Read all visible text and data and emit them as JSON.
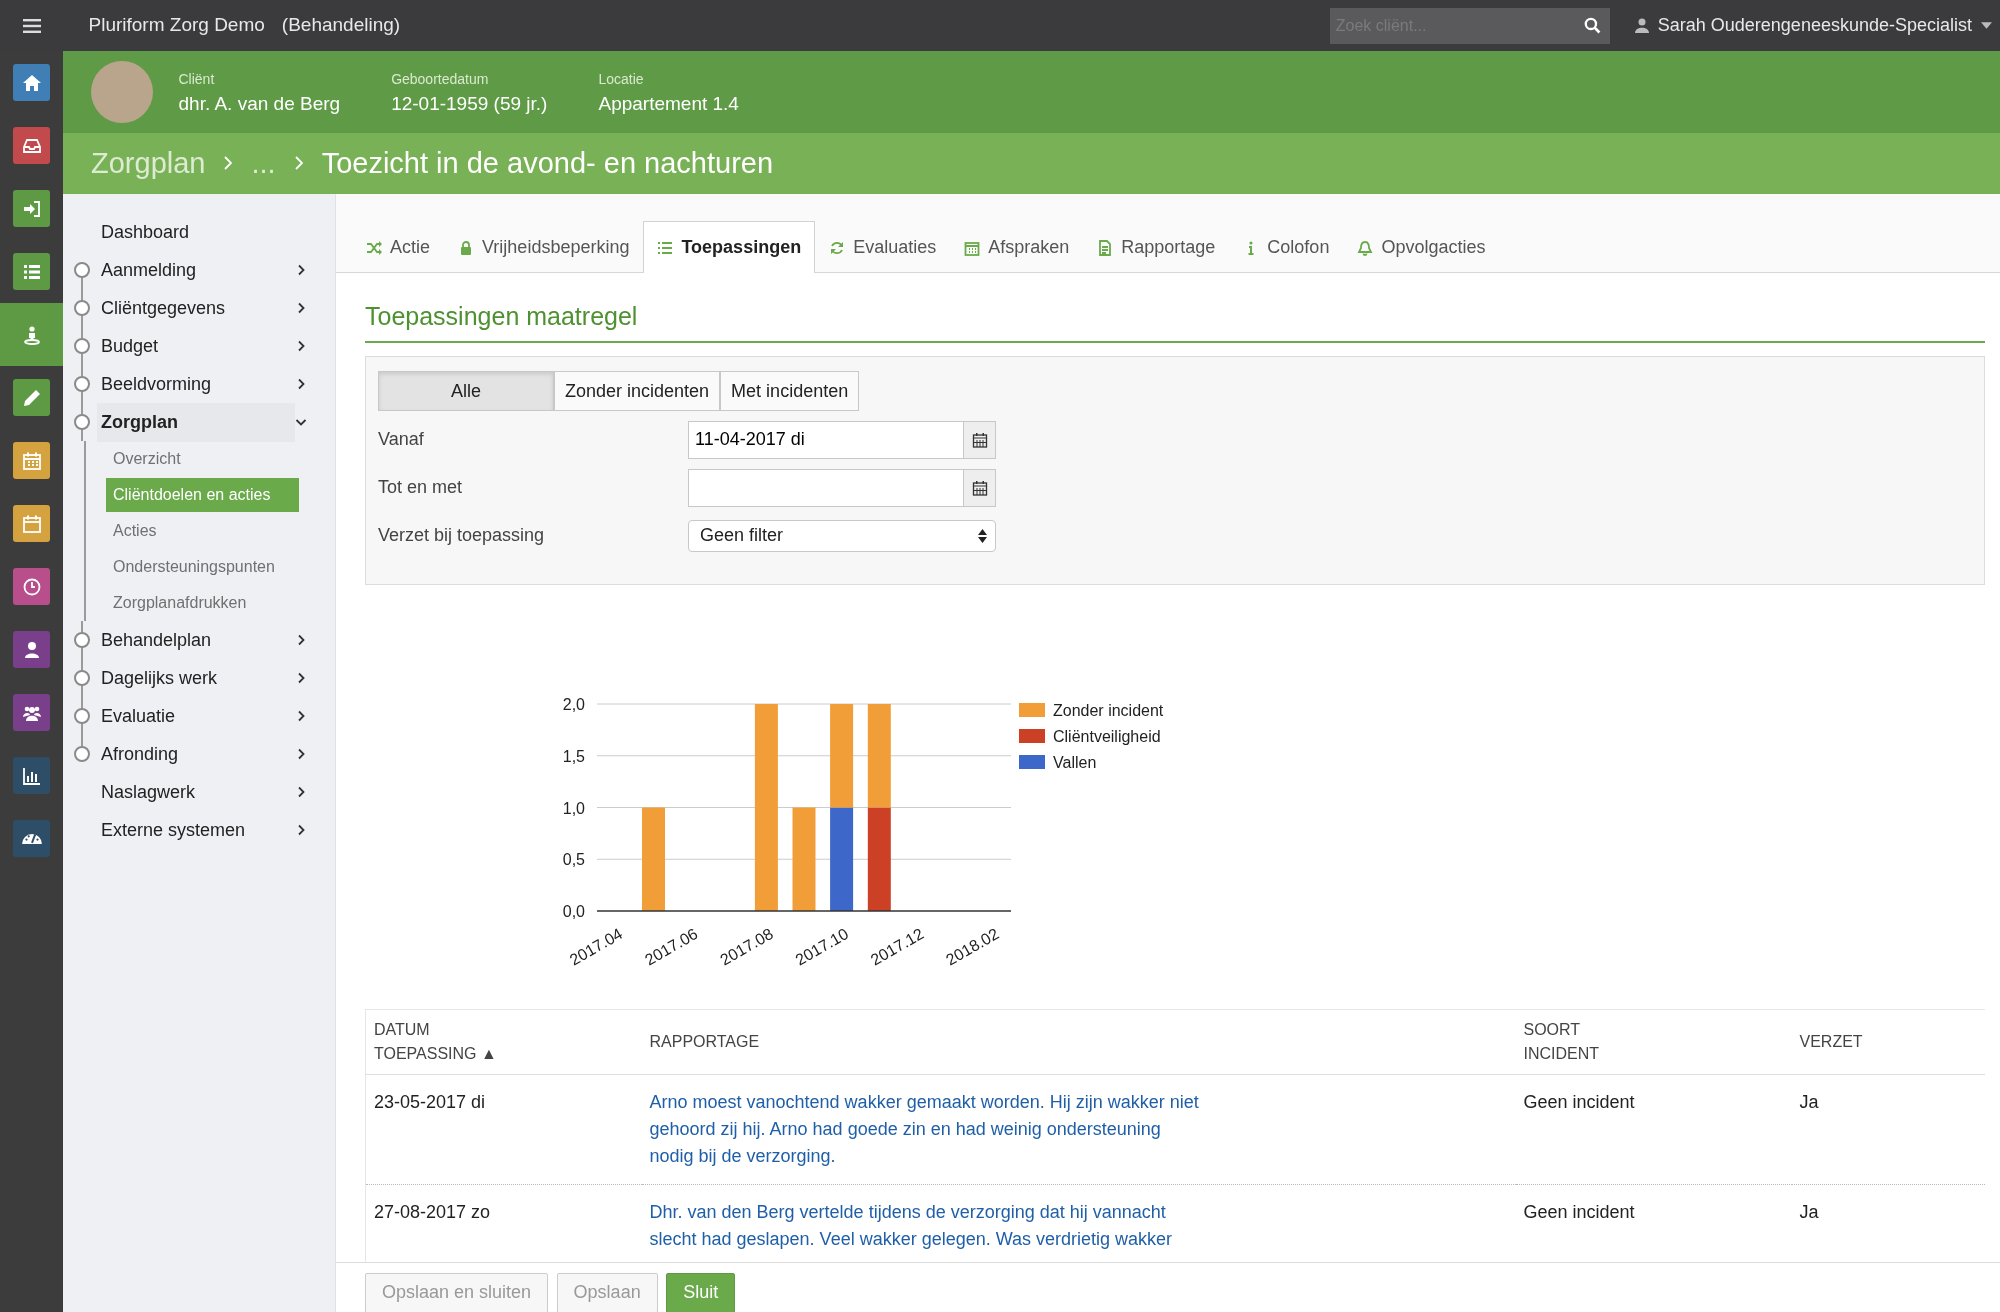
{
  "topbar": {
    "app_name": "Pluriform Zorg Demo",
    "mode": "(Behandeling)",
    "search": {
      "placeholder": "Zoek cliënt..."
    },
    "user": "Sarah Ouderengeneeskunde-Specialist"
  },
  "rail": [
    {
      "color": "#3f7fb5",
      "selected": false
    },
    {
      "color": "#c24a4c",
      "selected": false
    },
    {
      "color": "#5e9a44",
      "selected": false
    },
    {
      "color": "#5e9a44",
      "selected": false
    },
    {
      "color": "#5e9a44",
      "selected": true
    },
    {
      "color": "#5e9a44",
      "selected": false
    },
    {
      "color": "#d4a23e",
      "selected": false
    },
    {
      "color": "#d4a23e",
      "selected": false
    },
    {
      "color": "#b84e8c",
      "selected": false
    },
    {
      "color": "#7a3f8a",
      "selected": false
    },
    {
      "color": "#7a3f8a",
      "selected": false
    },
    {
      "color": "#2e4e68",
      "selected": false
    },
    {
      "color": "#2e4e68",
      "selected": false
    }
  ],
  "client": {
    "fields": [
      {
        "label": "Cliënt",
        "value": "dhr. A. van de Berg"
      },
      {
        "label": "Geboortedatum",
        "value": "12-01-1959 (59 jr.)"
      },
      {
        "label": "Locatie",
        "value": "Appartement 1.4"
      }
    ]
  },
  "breadcrumb": [
    "Zorgplan",
    "...",
    "Toezicht in de avond- en nachturen"
  ],
  "sidebar": {
    "items": [
      {
        "label": "Dashboard",
        "kind": "plain",
        "expandable": false,
        "expanded": false
      },
      {
        "label": "Aanmelding",
        "kind": "step",
        "expandable": true,
        "expanded": false
      },
      {
        "label": "Cliëntgegevens",
        "kind": "step",
        "expandable": true,
        "expanded": false
      },
      {
        "label": "Budget",
        "kind": "step",
        "expandable": true,
        "expanded": false
      },
      {
        "label": "Beeldvorming",
        "kind": "step",
        "expandable": true,
        "expanded": false
      },
      {
        "label": "Zorgplan",
        "kind": "step",
        "expandable": true,
        "expanded": true,
        "children": [
          {
            "label": "Overzicht",
            "selected": false
          },
          {
            "label": "Cliëntdoelen en acties",
            "selected": true
          },
          {
            "label": "Acties",
            "selected": false
          },
          {
            "label": "Ondersteuningspunten",
            "selected": false
          },
          {
            "label": "Zorgplanafdrukken",
            "selected": false
          }
        ]
      },
      {
        "label": "Behandelplan",
        "kind": "step",
        "expandable": true,
        "expanded": false
      },
      {
        "label": "Dagelijks werk",
        "kind": "step",
        "expandable": true,
        "expanded": false
      },
      {
        "label": "Evaluatie",
        "kind": "step",
        "expandable": true,
        "expanded": false
      },
      {
        "label": "Afronding",
        "kind": "step",
        "expandable": true,
        "expanded": false
      },
      {
        "label": "Naslagwerk",
        "kind": "plain",
        "expandable": true,
        "expanded": false
      },
      {
        "label": "Externe systemen",
        "kind": "plain",
        "expandable": true,
        "expanded": false
      }
    ]
  },
  "tabs": [
    {
      "label": "Actie",
      "selected": false
    },
    {
      "label": "Vrijheidsbeperking",
      "selected": false
    },
    {
      "label": "Toepassingen",
      "selected": true
    },
    {
      "label": "Evaluaties",
      "selected": false
    },
    {
      "label": "Afspraken",
      "selected": false
    },
    {
      "label": "Rapportage",
      "selected": false
    },
    {
      "label": "Colofon",
      "selected": false
    },
    {
      "label": "Opvolgacties",
      "selected": false
    }
  ],
  "section_title": "Toepassingen maatregel",
  "filter": {
    "segments": [
      {
        "label": "Alle",
        "selected": true
      },
      {
        "label": "Zonder incidenten",
        "selected": false
      },
      {
        "label": "Met incidenten",
        "selected": false
      }
    ],
    "fields": [
      {
        "label": "Vanaf",
        "kind": "date",
        "value": "11-04-2017 di"
      },
      {
        "label": "Tot en met",
        "kind": "date"
      },
      {
        "label": "Verzet bij toepassing",
        "kind": "select",
        "value": "Geen filter"
      }
    ]
  },
  "chart_data": {
    "type": "bar",
    "stacked": true,
    "grid": true,
    "legend": "right",
    "categories": [
      "2017.04",
      null,
      "2017.06",
      null,
      "2017.08",
      null,
      "2017.10",
      null,
      "2017.12",
      null,
      "2018.02"
    ],
    "series": [
      {
        "name": "Zonder incident",
        "color": "#f29e38",
        "values": [
          0,
          1,
          0,
          0,
          2,
          1,
          1,
          1,
          0,
          0,
          0
        ]
      },
      {
        "name": "Cliëntveiligheid",
        "color": "#cc4125",
        "values": [
          0,
          0,
          0,
          0,
          0,
          0,
          0,
          1,
          0,
          0,
          0
        ]
      },
      {
        "name": "Vallen",
        "color": "#3d67c8",
        "values": [
          0,
          0,
          0,
          0,
          0,
          0,
          1,
          0,
          0,
          0,
          0
        ]
      }
    ],
    "ylim": [
      0,
      2
    ],
    "yticks": [
      {
        "value": 0,
        "label": "0,0"
      },
      {
        "value": 0.5,
        "label": "0,5"
      },
      {
        "value": 1,
        "label": "1,0"
      },
      {
        "value": 1.5,
        "label": "1,5"
      },
      {
        "value": 2,
        "label": "2,0"
      }
    ]
  },
  "table": {
    "columns": [
      "DATUM TOEPASSING ▲",
      "RAPPORTAGE",
      "SOORT INCIDENT",
      "VERZET"
    ],
    "rows": [
      {
        "cells": [
          "23-05-2017 di",
          "Arno moest vanochtend wakker gemaakt worden. Hij zijn wakker niet gehoord zij hij. Arno had goede zin en had weinig ondersteuning nodig bij de verzorging.",
          "Geen incident",
          "Ja"
        ]
      },
      {
        "cells": [
          "27-08-2017 zo",
          "Dhr. van den Berg vertelde tijdens de verzorging dat hij vannacht slecht had geslapen. Veel wakker gelegen. Was verdrietig wakker",
          "Geen incident",
          "Ja"
        ]
      }
    ]
  },
  "footer_buttons": [
    {
      "label": "Opslaan en sluiten",
      "kind": "secondary",
      "disabled": true
    },
    {
      "label": "Opslaan",
      "kind": "secondary",
      "disabled": true
    },
    {
      "label": "Sluit",
      "kind": "primary",
      "disabled": false
    }
  ]
}
